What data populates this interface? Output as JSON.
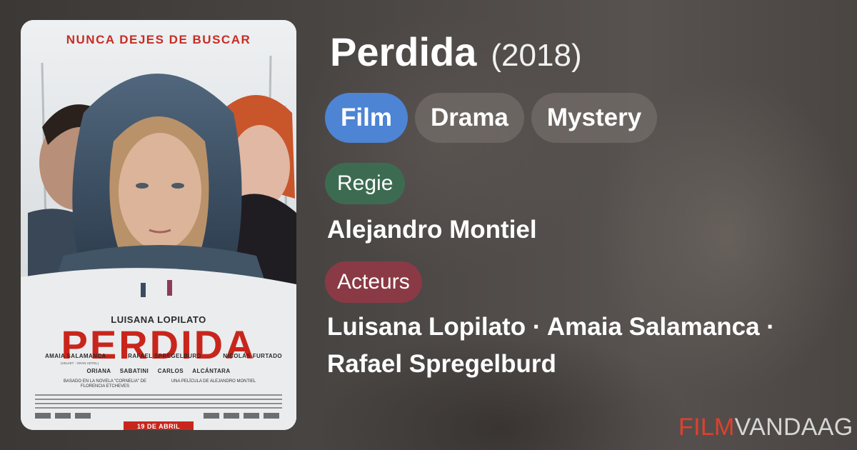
{
  "movie": {
    "title": "Perdida",
    "year": "(2018)"
  },
  "tags": [
    {
      "label": "Film",
      "color": "#4d84d4"
    },
    {
      "label": "Drama"
    },
    {
      "label": "Mystery"
    }
  ],
  "director": {
    "label": "Regie",
    "label_color": "#3d6b51",
    "name": "Alejandro Montiel"
  },
  "actors": {
    "label": "Acteurs",
    "label_color": "#8a3a45",
    "names": "Luisana Lopilato · Amaia Salamanca · Rafael Spregelburd"
  },
  "poster": {
    "tagline": "NUNCA DEJES DE BUSCAR",
    "lead_actor": "LUISANA LOPILATO",
    "title": "PERDIDA",
    "cast_row1": [
      "AMAIA SALAMANCA",
      "RAFAEL SPREGELBURD",
      "NICOLÁS FURTADO"
    ],
    "cast_note": "(VELVET · GRAN HOTEL)",
    "cast_row2": "ORIANA SABATINI   CARLOS ALCÁNTARA",
    "credit_left": "BASADO EN LA NOVELA \"CORNELIA\" DE FLORENCIA ETCHEVES",
    "credit_right": "UNA PELÍCULA DE ALEJANDRO MONTIEL",
    "release_date": "19 DE ABRIL"
  },
  "brand": {
    "part1": "FILM",
    "part2": "VANDAAG",
    "accent": "#e0402d"
  }
}
